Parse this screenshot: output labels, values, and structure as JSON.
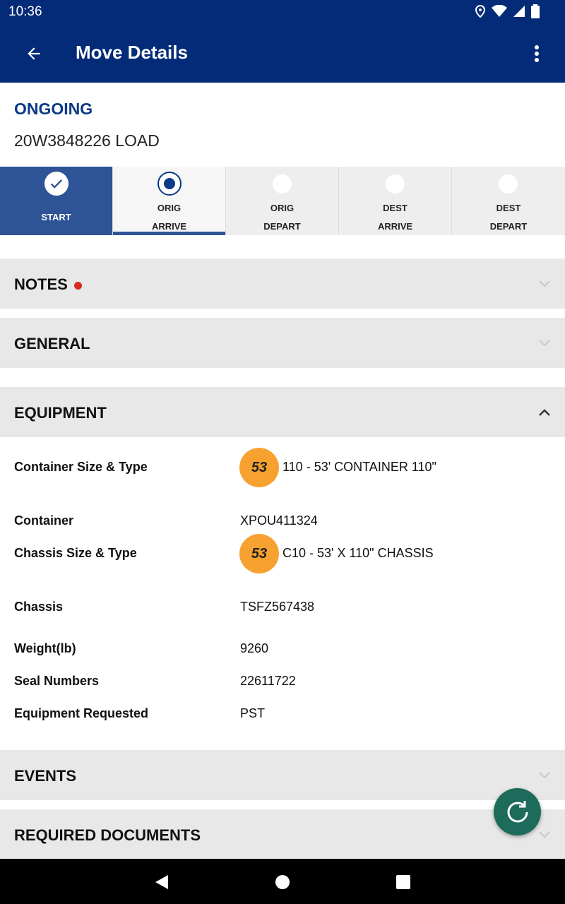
{
  "status_bar": {
    "time": "10:36"
  },
  "app_bar": {
    "title": "Move Details"
  },
  "move": {
    "status": "ONGOING",
    "load_id": "20W3848226 LOAD"
  },
  "steps": [
    {
      "line1": "START",
      "line2": "",
      "state": "done"
    },
    {
      "line1": "ORIG",
      "line2": "ARRIVE",
      "state": "current"
    },
    {
      "line1": "ORIG",
      "line2": "DEPART",
      "state": "pending"
    },
    {
      "line1": "DEST",
      "line2": "ARRIVE",
      "state": "pending"
    },
    {
      "line1": "DEST",
      "line2": "DEPART",
      "state": "pending"
    }
  ],
  "sections": {
    "notes": "NOTES",
    "general": "GENERAL",
    "equipment": "EQUIPMENT",
    "events": "EVENTS",
    "required_documents": "REQUIRED DOCUMENTS"
  },
  "equipment": {
    "container_size_type": {
      "label": "Container Size & Type",
      "badge": "53",
      "value": "110 - 53' CONTAINER 110\""
    },
    "container": {
      "label": "Container",
      "value": "XPOU411324"
    },
    "chassis_size_type": {
      "label": "Chassis Size & Type",
      "badge": "53",
      "value": "C10 - 53' X 110\" CHASSIS"
    },
    "chassis": {
      "label": "Chassis",
      "value": "TSFZ567438"
    },
    "weight": {
      "label": "Weight(lb)",
      "value": "9260"
    },
    "seal_numbers": {
      "label": "Seal Numbers",
      "value": "22611722"
    },
    "equipment_requested": {
      "label": "Equipment Requested",
      "value": "PST"
    }
  },
  "colors": {
    "primary": "#032b78",
    "step_done": "#2e5397",
    "badge": "#f7a230",
    "fab": "#1d6b5a",
    "notes_indicator": "#d72a20"
  },
  "icons": {
    "back": "arrow-back-icon",
    "menu": "more-vert-icon",
    "refresh": "refresh-icon"
  }
}
